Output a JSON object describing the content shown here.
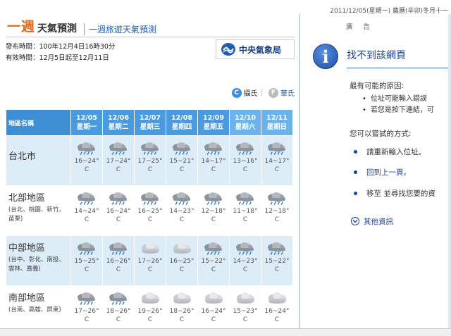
{
  "top": {
    "date": "2011/12/05(星期一) 農曆(辛卯)冬月十一"
  },
  "header": {
    "title_main": "一週",
    "title_sub": "天氣預測",
    "travel_link": "一週旅遊天氣預測"
  },
  "meta": {
    "publish_label": "發布時間：",
    "publish_value": "100年12月4日16時30分",
    "valid_label": "有效時間：",
    "valid_value": "12月5日起至12月11日"
  },
  "logo": {
    "text": "中央氣象局"
  },
  "units": {
    "celsius_icon": "C",
    "celsius_label": "攝氏",
    "fahrenheit_icon": "F",
    "fahrenheit_label": "華氏",
    "separator": "|"
  },
  "table": {
    "region_header": "地區名稱",
    "days": [
      {
        "date": "12/05",
        "weekday": "星期一"
      },
      {
        "date": "12/06",
        "weekday": "星期二"
      },
      {
        "date": "12/07",
        "weekday": "星期三"
      },
      {
        "date": "12/08",
        "weekday": "星期四"
      },
      {
        "date": "12/09",
        "weekday": "星期五"
      },
      {
        "date": "12/10",
        "weekday": "星期六"
      },
      {
        "date": "12/11",
        "weekday": "星期日"
      }
    ],
    "unit": "C",
    "rows": [
      {
        "name": "台北市",
        "sub": "",
        "cells": [
          {
            "temp": "16~24°",
            "icon": "cloud-rain-icon"
          },
          {
            "temp": "17~24°",
            "icon": "cloud-rain-icon"
          },
          {
            "temp": "17~25°",
            "icon": "cloud-rain-icon"
          },
          {
            "temp": "15~21°",
            "icon": "cloud-rain-icon"
          },
          {
            "temp": "14~17°",
            "icon": "cloud-rain-icon"
          },
          {
            "temp": "13~16°",
            "icon": "cloud-rain-icon"
          },
          {
            "temp": "14~17°",
            "icon": "cloud-rain-icon"
          }
        ]
      },
      {
        "name": "北部地區",
        "sub": "(台北、桃園、新竹、苗栗)",
        "cells": [
          {
            "temp": "14~24°",
            "icon": "cloud-rain-icon"
          },
          {
            "temp": "16~24°",
            "icon": "cloud-rain-icon"
          },
          {
            "temp": "16~25°",
            "icon": "cloud-rain-icon"
          },
          {
            "temp": "14~23°",
            "icon": "cloud-rain-icon"
          },
          {
            "temp": "12~18°",
            "icon": "cloud-rain-icon"
          },
          {
            "temp": "11~18°",
            "icon": "cloud-rain-icon"
          },
          {
            "temp": "12~18°",
            "icon": "cloud-rain-icon"
          }
        ]
      },
      {
        "name": "中部地區",
        "sub": "(台中、彰化、南投、雲林、嘉義)",
        "cells": [
          {
            "temp": "15~25°",
            "icon": "cloud-rain-icon"
          },
          {
            "temp": "16~26°",
            "icon": "cloud-rain-icon"
          },
          {
            "temp": "17~26°",
            "icon": "cloudy-icon"
          },
          {
            "temp": "16~25°",
            "icon": "cloudy-icon"
          },
          {
            "temp": "15~22°",
            "icon": "cloud-rain-icon"
          },
          {
            "temp": "14~23°",
            "icon": "cloud-rain-icon"
          },
          {
            "temp": "15~22°",
            "icon": "cloud-rain-icon"
          }
        ]
      },
      {
        "name": "南部地區",
        "sub": "(台南、高雄、屏東)",
        "cells": [
          {
            "temp": "17~26°",
            "icon": "cloud-rain-icon"
          },
          {
            "temp": "18~26°",
            "icon": "cloud-rain-icon"
          },
          {
            "temp": "19~26°",
            "icon": "cloudy-icon"
          },
          {
            "temp": "18~26°",
            "icon": "cloudy-icon"
          },
          {
            "temp": "16~24°",
            "icon": "cloudy-icon"
          },
          {
            "temp": "15~23°",
            "icon": "cloudy-icon"
          },
          {
            "temp": "16~24°",
            "icon": "cloudy-icon"
          }
        ]
      }
    ]
  },
  "side_panel": {
    "ad_label": "廣 告",
    "error_title": "找不到該網頁",
    "causes_title": "最有可能的原因:",
    "causes": [
      "位址可能輸入錯誤",
      "若您是按下連結，可"
    ],
    "try_title": "您可以嘗試的方式:",
    "actions": [
      "請重新輸入位址。",
      "回到上一頁。",
      "移至  並尋找您要的資"
    ],
    "more_info": "其他資訊"
  }
}
